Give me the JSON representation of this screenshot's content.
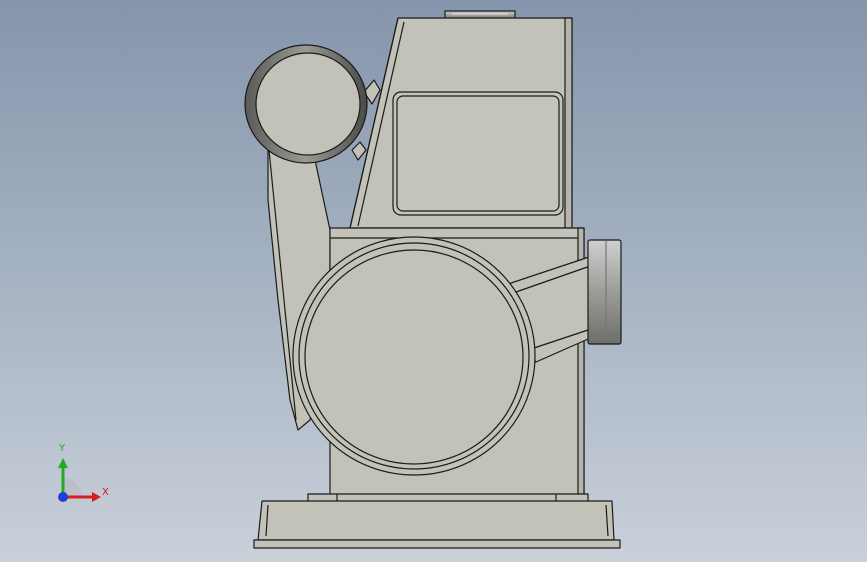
{
  "viewport": {
    "background_top": "#8595ab",
    "background_bottom": "#c9d0d9"
  },
  "model": {
    "body_color": "#c2c2b8",
    "edge_color": "#1a1a1a",
    "pipe_color": "#8a8a85"
  },
  "triad": {
    "y_label": "Y",
    "x_label": "X",
    "y_color": "#22aa22",
    "x_color": "#d42020",
    "z_color": "#1f3fd6",
    "icon": "coordinate-triad-icon"
  }
}
